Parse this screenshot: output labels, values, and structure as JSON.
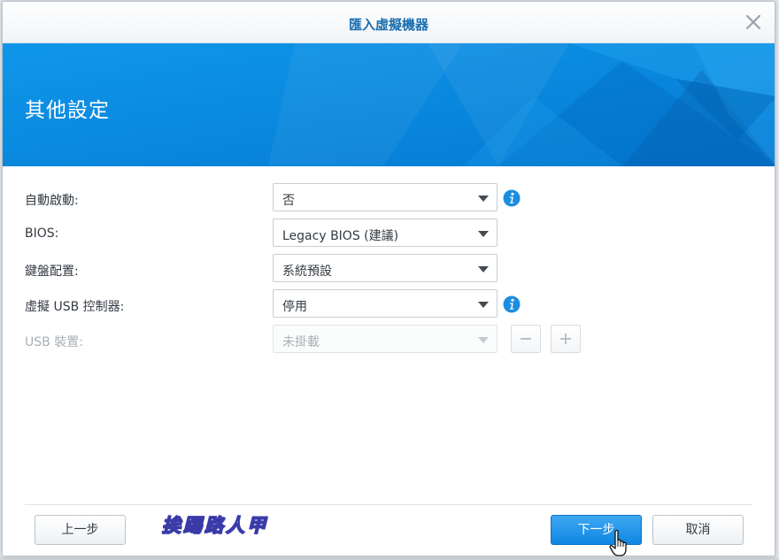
{
  "dialog": {
    "title": "匯入虛擬機器",
    "close_icon": "close-icon"
  },
  "banner": {
    "title": "其他設定",
    "color": "#0a8de3"
  },
  "form": {
    "autostart": {
      "label": "自動啟動:",
      "value": "否",
      "info_icon": "info-icon"
    },
    "bios": {
      "label": "BIOS:",
      "value": "Legacy BIOS (建議)"
    },
    "keyboard": {
      "label": "鍵盤配置:",
      "value": "系統預設"
    },
    "usb_controller": {
      "label": "虛擬 USB 控制器:",
      "value": "停用",
      "info_icon": "info-icon"
    },
    "usb_device": {
      "label": "USB 裝置:",
      "value": "未掛載",
      "disabled": true
    }
  },
  "footer": {
    "back_label": "上一步",
    "next_label": "下一步",
    "cancel_label": "取消",
    "watermark": "挨踢路人甲",
    "accent": "#1a8ae6"
  }
}
